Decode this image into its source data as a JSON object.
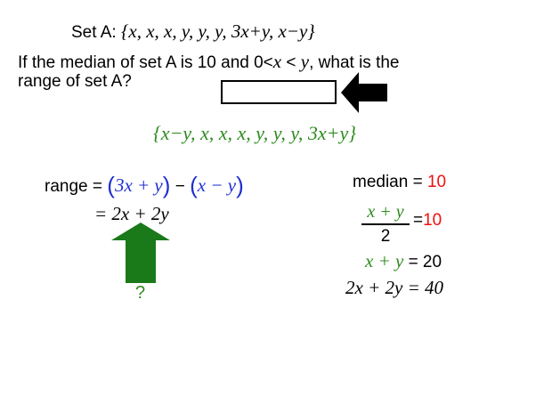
{
  "set_a": {
    "label": "Set A:",
    "elements": "{x, x, x, y, y, y, 3x+y, x−y}"
  },
  "question": {
    "line1_start": "If the median of set A is 10 and 0<",
    "line1_var1": "x",
    "line1_mid": " < ",
    "line1_var2": "y",
    "line1_end": ", what is the",
    "line2": "range of set A?"
  },
  "answer_box": {
    "value": ""
  },
  "ordered_set": "{x−y, x, x, x, y, y, y, 3x+y}",
  "range_work": {
    "label": "range =",
    "term1": "3x + y",
    "minus": "−",
    "term2": "x − y",
    "result": "= 2x + 2y",
    "question_mark": "?"
  },
  "median_work": {
    "line1_label": "median =",
    "line1_value": "10",
    "frac_num": "x + y",
    "frac_den": "2",
    "frac_eq": "=",
    "frac_value": "10",
    "line3_lhs": "x + y",
    "line3_rhs": "= 20",
    "line4": "2x + 2y = 40"
  },
  "colors": {
    "green": "#2e8b1f",
    "red": "#e11",
    "blue": "#1f2fd0",
    "arrow_green": "#1a7a1a",
    "arrow_black": "#000000"
  }
}
